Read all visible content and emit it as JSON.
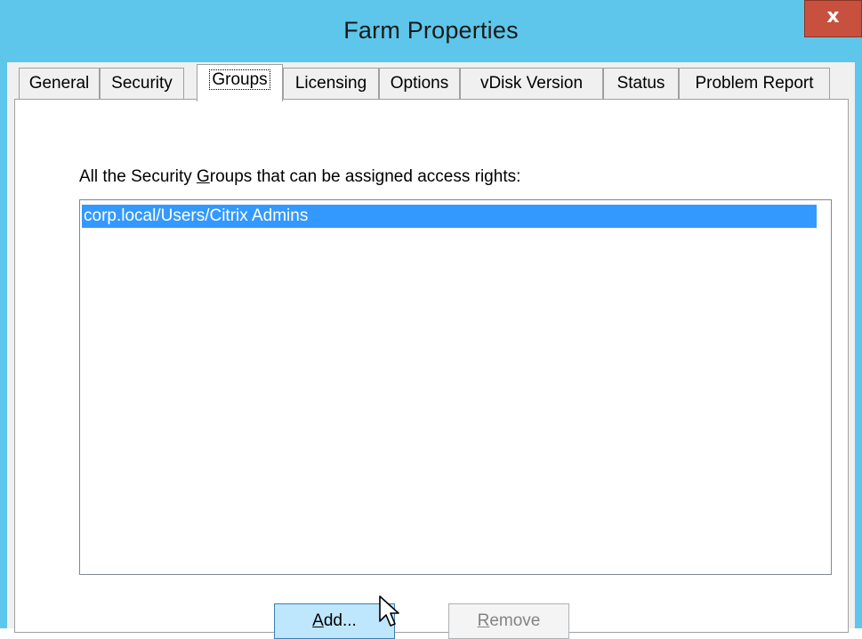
{
  "window": {
    "title": "Farm Properties",
    "close_label": "x"
  },
  "tabs": [
    {
      "label": "General",
      "active": false
    },
    {
      "label": "Security",
      "active": false
    },
    {
      "label": "Groups",
      "active": true
    },
    {
      "label": "Licensing",
      "active": false
    },
    {
      "label": "Options",
      "active": false
    },
    {
      "label": "vDisk Version",
      "active": false
    },
    {
      "label": "Status",
      "active": false
    },
    {
      "label": "Problem Report",
      "active": false
    }
  ],
  "groups_panel": {
    "label_before": "All the Security ",
    "label_mnemonic": "G",
    "label_after": "roups that can be assigned access rights:",
    "list_items": [
      {
        "text": "corp.local/Users/Citrix Admins",
        "selected": true
      }
    ]
  },
  "buttons": {
    "add_mnemonic": "A",
    "add_rest": "dd...",
    "remove_mnemonic": "R",
    "remove_rest": "emove"
  },
  "colors": {
    "titlebar": "#5ec6ea",
    "close_button": "#c7503e",
    "selection": "#3399ff",
    "add_button_hover": "#bee6fd"
  },
  "icons": {
    "close": "close-icon",
    "cursor": "mouse-pointer-icon"
  }
}
